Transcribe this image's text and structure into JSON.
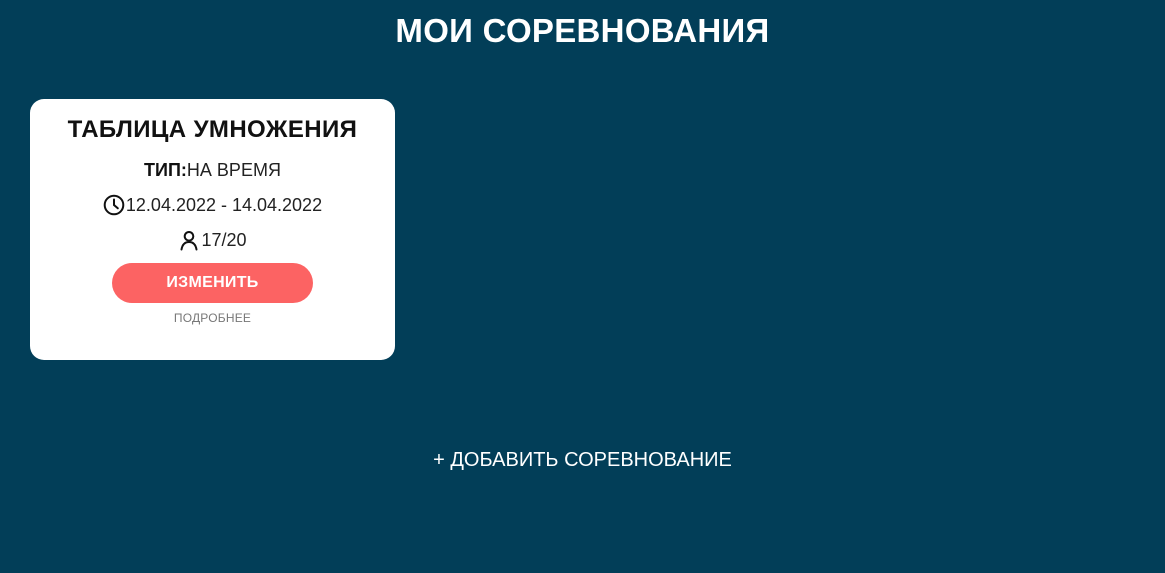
{
  "header": {
    "title": "МОИ СОРЕВНОВАНИЯ"
  },
  "competitions": [
    {
      "title": "ТАБЛИЦА УМНОЖЕНИЯ",
      "type_label": "ТИП:",
      "type_value": "НА ВРЕМЯ",
      "dates": "12.04.2022 - 14.04.2022",
      "participants": "17/20",
      "edit_label": "ИЗМЕНИТЬ",
      "details_label": "ПОДРОБНЕЕ",
      "icons": {
        "dates": "clock-icon",
        "participants": "user-icon"
      }
    }
  ],
  "actions": {
    "add_competition_label": "+ ДОБАВИТЬ СОРЕВНОВАНИЕ"
  },
  "colors": {
    "background": "#023e58",
    "card": "#ffffff",
    "accent": "#fc6363"
  }
}
